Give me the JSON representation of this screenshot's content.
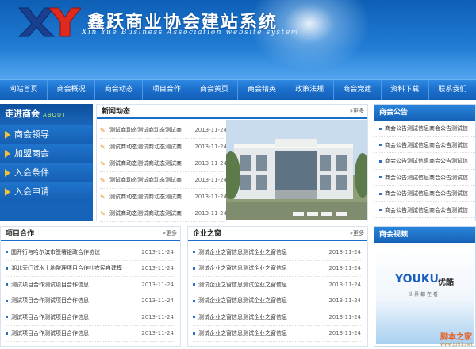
{
  "header": {
    "title": "鑫跃商业协会建站系统",
    "subtitle": "Xin Yue Business Association website system"
  },
  "nav": [
    "网站首页",
    "商会概况",
    "商会动态",
    "项目合作",
    "商会黄页",
    "商会精英",
    "政策法规",
    "商会党建",
    "资料下载",
    "联系我们"
  ],
  "sidebar": {
    "title": "走进商会",
    "title_en": "ABOUT",
    "items": [
      "商会领导",
      "加盟商会",
      "入会条件",
      "入会申请"
    ]
  },
  "news": {
    "title": "新闻动态",
    "more": "更多",
    "items": [
      {
        "text": "测试商动态测试商动态测试商",
        "date": "2013-11-24"
      },
      {
        "text": "测试商动态测试商动态测试商",
        "date": "2013-11-24"
      },
      {
        "text": "测试商动态测试商动态测试商",
        "date": "2013-11-24"
      },
      {
        "text": "测试商动态测试商动态测试商",
        "date": "2013-11-24"
      },
      {
        "text": "测试商动态测试商动态测试商",
        "date": "2013-11-24"
      },
      {
        "text": "测试商动态测试商动态测试商",
        "date": "2013-11-24"
      }
    ]
  },
  "notice": {
    "title": "商会公告",
    "items": [
      "商会公告测试信息商会公告测试信",
      "商会公告测试信息商会公告测试信",
      "商会公告测试信息商会公告测试信",
      "商会公告测试信息商会公告测试信",
      "商会公告测试信息商会公告测试信",
      "商会公告测试信息商会公告测试信"
    ]
  },
  "projects": {
    "title": "项目合作",
    "more": "更多",
    "items": [
      {
        "text": "国开行与哈尔滨市签署银政合作协议",
        "date": "2013-11-24"
      },
      {
        "text": "湖北天门试水土地整理项目合作社农民自建模",
        "date": "2013-11-24"
      },
      {
        "text": "测试项目合作测试项目合作信息",
        "date": "2013-11-24"
      },
      {
        "text": "测试项目合作测试项目合作信息",
        "date": "2013-11-24"
      },
      {
        "text": "测试项目合作测试项目合作信息",
        "date": "2013-11-24"
      },
      {
        "text": "测试项目合作测试项目合作信息",
        "date": "2013-11-24"
      }
    ]
  },
  "enterprise": {
    "title": "企业之窗",
    "more": "更多",
    "items": [
      {
        "text": "测试企业之窗信息测试企业之窗信息",
        "date": "2013-11-24"
      },
      {
        "text": "测试企业之窗信息测试企业之窗信息",
        "date": "2013-11-24"
      },
      {
        "text": "测试企业之窗信息测试企业之窗信息",
        "date": "2013-11-24"
      },
      {
        "text": "测试企业之窗信息测试企业之窗信息",
        "date": "2013-11-24"
      },
      {
        "text": "测试企业之窗信息测试企业之窗信息",
        "date": "2013-11-24"
      },
      {
        "text": "测试企业之窗信息测试企业之窗信息",
        "date": "2013-11-24"
      }
    ]
  },
  "video": {
    "title": "商会视频",
    "brand": "YOUKU",
    "brand_cn": "优酷",
    "slogan": "世界都在看"
  },
  "watermark": {
    "text": "脚本之家",
    "url": "www.jb51.net"
  }
}
